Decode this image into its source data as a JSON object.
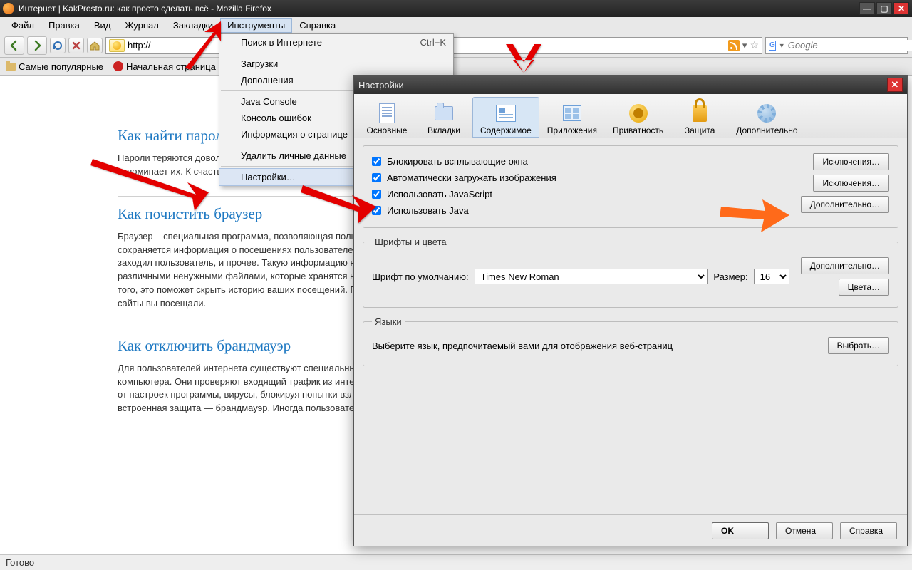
{
  "window": {
    "title": "Интернет | KakProsto.ru: как просто сделать всё - Mozilla Firefox"
  },
  "menubar": {
    "file": "Файл",
    "edit": "Правка",
    "view": "Вид",
    "history": "Журнал",
    "bookmarks": "Закладки",
    "tools": "Инструменты",
    "help": "Справка"
  },
  "toolbar": {
    "url_value": "http://",
    "search_placeholder": "Google",
    "search_engine_letter": "G"
  },
  "bookmarks_bar": {
    "popular": "Самые популярные",
    "startpage": "Начальная страница"
  },
  "tools_menu": {
    "web_search": "Поиск в Интернете",
    "web_search_shortcut": "Ctrl+K",
    "downloads": "Загрузки",
    "addons": "Дополнения",
    "java_console": "Java Console",
    "error_console": "Консоль ошибок",
    "page_info": "Информация о странице",
    "clear_private": "Удалить личные данные",
    "options": "Настройки…"
  },
  "page": {
    "a1_title": "Как найти пароль",
    "a1_text": "Пароли теряются довольно часто. Мы используем огромное количество сервисов, полагаясь на браузер, который запоминает их. К счастью, найти утерянный пароль возможно — можно найти пароль, скрытый за значками «*».",
    "a2_title": "Как почистить браузер",
    "a2_text": "Браузер – специальная программа, позволяющая пользоваться всемирной сетью Internet. В любом из браузеров сохраняется информация о посещениях пользователем различных сайтов: временные файлы, адреса страниц, куда заходил пользователь, и прочее. Такую информацию необходимо периодически удалять, чтобы не засорять компьютер различными ненужными файлами, которые хранятся на жестком диске, не выполняя никаких полезных функций. Кроме того, это поможет скрыть историю ваших посещений. Посторонний, сев за ваш компьютер, не сможет узнать, какие именно сайты вы посещали.",
    "a3_title": "Как отключить брандмауэр",
    "a3_text": "Для пользователей интернета существуют специальные защитные программы, которые обеспечивают безопасность компьютера. Они проверяют входящий трафик из интернета. Затем либо блокируют их, либо пропускают — в зависимости от настроек программы, вирусы, блокируя попытки взлома компьютера. В операционной системе Windows существует своя встроенная защита — брандмауэр. Иногда пользователю необходимо отключить его."
  },
  "statusbar": {
    "text": "Готово"
  },
  "dialog": {
    "title": "Настройки",
    "tabs": {
      "main": "Основные",
      "tabsLbl": "Вкладки",
      "content": "Содержимое",
      "apps": "Приложения",
      "privacy": "Приватность",
      "security": "Защита",
      "advanced": "Дополнительно"
    },
    "content_pane": {
      "block_popups": "Блокировать всплывающие окна",
      "load_images": "Автоматически загружать изображения",
      "use_js": "Использовать JavaScript",
      "use_java": "Использовать Java",
      "exceptions_btn": "Исключения…",
      "advanced_btn": "Дополнительно…",
      "fonts_legend": "Шрифты и цвета",
      "default_font_label": "Шрифт по умолчанию:",
      "default_font_value": "Times New Roman",
      "size_label": "Размер:",
      "size_value": "16",
      "colors_btn": "Цвета…",
      "lang_legend": "Языки",
      "lang_text": "Выберите язык, предпочитаемый вами для отображения веб-страниц",
      "choose_btn": "Выбрать…"
    },
    "buttons": {
      "ok": "OK",
      "cancel": "Отмена",
      "help": "Справка"
    }
  }
}
